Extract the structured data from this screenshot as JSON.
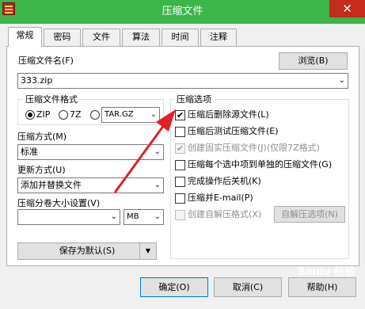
{
  "window": {
    "title": "压缩文件"
  },
  "tabs": [
    "常规",
    "密码",
    "文件",
    "算法",
    "时间",
    "注释"
  ],
  "archive_name": {
    "label": "压缩文件名(F)",
    "value": "333.zip",
    "browse_label": "浏览(B)"
  },
  "format": {
    "group_label": "压缩文件格式",
    "options": [
      "ZIP",
      "7Z",
      "TAR.GZ"
    ],
    "selected": "ZIP"
  },
  "method": {
    "label": "压缩方式(M)",
    "value": "标准"
  },
  "update": {
    "label": "更新方式(U)",
    "value": "添加并替换文件"
  },
  "split": {
    "label": "压缩分卷大小设置(V)",
    "value": "",
    "unit": "MB"
  },
  "save_default_label": "保存为默认(S)",
  "options_group": {
    "label": "压缩选项",
    "items": [
      {
        "label": "压缩后删除源文件(L)",
        "checked": true,
        "enabled": true
      },
      {
        "label": "压缩后测试压缩文件(E)",
        "checked": false,
        "enabled": true
      },
      {
        "label": "创建固实压缩文件(J)(仅限7Z格式)",
        "checked": true,
        "enabled": false
      },
      {
        "label": "压缩每个选中项到单独的压缩文件(G)",
        "checked": false,
        "enabled": true
      },
      {
        "label": "完成操作后关机(K)",
        "checked": false,
        "enabled": true
      },
      {
        "label": "压缩并E-mail(P)",
        "checked": false,
        "enabled": true
      },
      {
        "label": "创建自解压格式(X)",
        "checked": false,
        "enabled": false
      }
    ],
    "sfx_options_label": "自解压选项(N)"
  },
  "footer": {
    "ok_label": "确定(O)",
    "cancel_label": "取消(C)",
    "help_label": "帮助(H)"
  },
  "watermark": "Baidu 经验",
  "colors": {
    "titlebar": "#3cb54a",
    "arrow": "#e0202a",
    "close": "#c42b1c"
  }
}
